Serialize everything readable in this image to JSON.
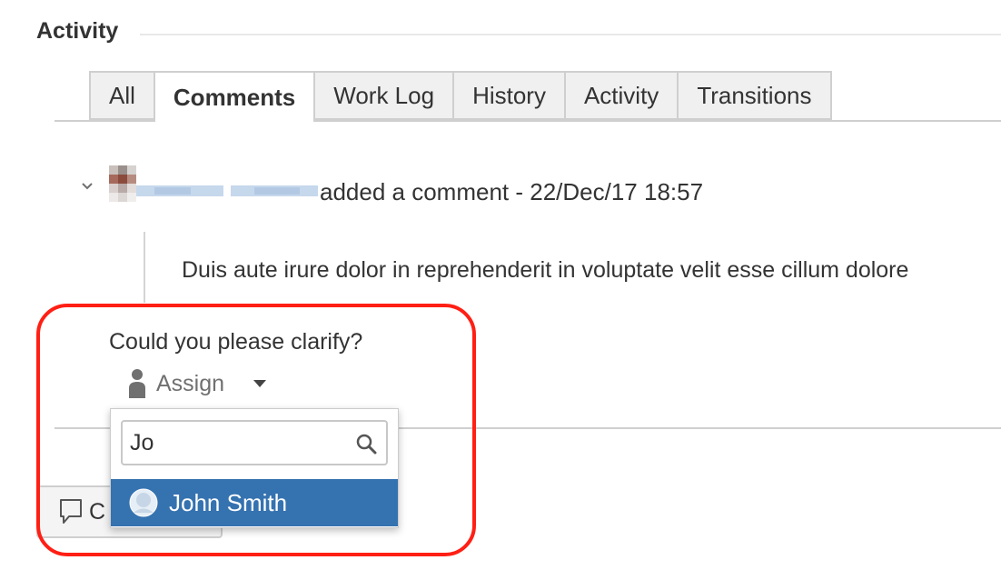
{
  "activity": {
    "title": "Activity",
    "tabs": [
      {
        "label": "All",
        "active": false
      },
      {
        "label": "Comments",
        "active": true
      },
      {
        "label": "Work Log",
        "active": false
      },
      {
        "label": "History",
        "active": false
      },
      {
        "label": "Activity",
        "active": false
      },
      {
        "label": "Transitions",
        "active": false
      }
    ]
  },
  "comment": {
    "action_text": "added a comment - 22/Dec/17 18:57",
    "body": "Duis aute irure dolor in reprehenderit in voluptate velit esse cillum dolore"
  },
  "task": {
    "text": "Could you please clarify?",
    "assign_label": "Assign"
  },
  "assignee_picker": {
    "search_value": "Jo",
    "options": [
      {
        "label": "John Smith",
        "selected": true
      }
    ]
  },
  "comment_button": {
    "label": "C"
  },
  "colors": {
    "highlight": "#ff1f14",
    "selected_option": "#3572b0",
    "tab_border": "#cfcfcf"
  }
}
